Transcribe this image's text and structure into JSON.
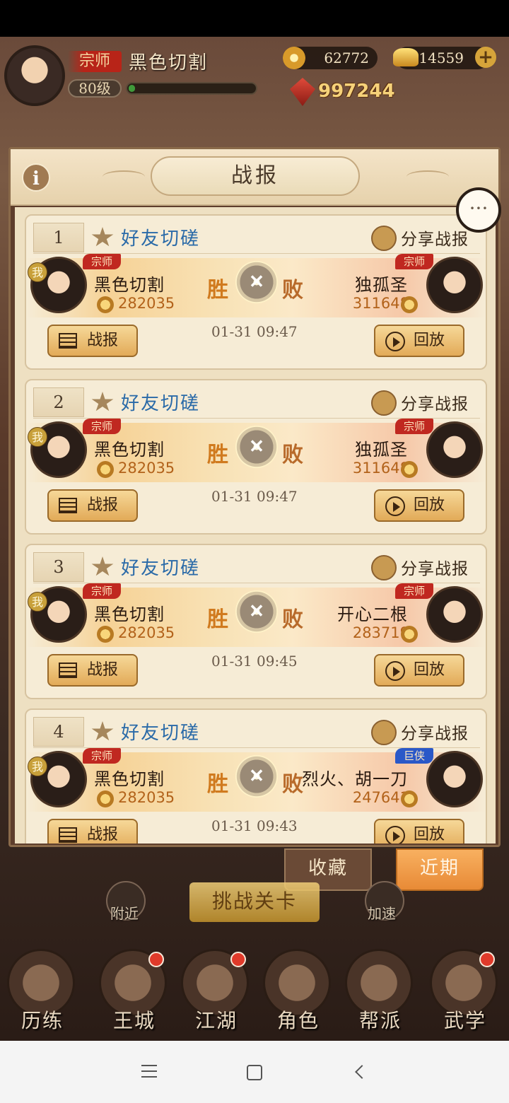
{
  "hud": {
    "rank": "宗师",
    "player_name": "黑色切割",
    "level": "80级",
    "exp_fraction": 0.05,
    "copper": "62772",
    "gold": "14559",
    "power": "997244"
  },
  "dialog": {
    "title": "战报",
    "info_icon": "i",
    "chat_icon": "···"
  },
  "cards": [
    {
      "index": "1",
      "type": "好友切磋",
      "share": "分享战报",
      "me_badge": "我",
      "left": {
        "title": "宗师",
        "name": "黑色切割",
        "power": "282035"
      },
      "right": {
        "title": "宗师",
        "name": "独孤圣",
        "power": "311648",
        "title_color": "red"
      },
      "win": "胜",
      "lose": "败",
      "time": "01-31 09:47",
      "report_btn": "战报",
      "replay_btn": "回放"
    },
    {
      "index": "2",
      "type": "好友切磋",
      "share": "分享战报",
      "me_badge": "我",
      "left": {
        "title": "宗师",
        "name": "黑色切割",
        "power": "282035"
      },
      "right": {
        "title": "宗师",
        "name": "独孤圣",
        "power": "311648",
        "title_color": "red"
      },
      "win": "胜",
      "lose": "败",
      "time": "01-31 09:47",
      "report_btn": "战报",
      "replay_btn": "回放"
    },
    {
      "index": "3",
      "type": "好友切磋",
      "share": "分享战报",
      "me_badge": "我",
      "left": {
        "title": "宗师",
        "name": "黑色切割",
        "power": "282035"
      },
      "right": {
        "title": "宗师",
        "name": "开心二根",
        "power": "283719",
        "title_color": "red"
      },
      "win": "胜",
      "lose": "败",
      "time": "01-31 09:45",
      "report_btn": "战报",
      "replay_btn": "回放"
    },
    {
      "index": "4",
      "type": "好友切磋",
      "share": "分享战报",
      "me_badge": "我",
      "left": {
        "title": "宗师",
        "name": "黑色切割",
        "power": "282035"
      },
      "right": {
        "title": "巨侠",
        "name": "烈火、胡一刀",
        "power": "247641",
        "title_color": "blue"
      },
      "win": "胜",
      "lose": "败",
      "time": "01-31 09:43",
      "report_btn": "战报",
      "replay_btn": "回放"
    }
  ],
  "tabs": {
    "favorites": "收藏",
    "recent": "近期"
  },
  "challenge_button": "挑战关卡",
  "side": {
    "nearby": "附近",
    "speed": "加速"
  },
  "nav": [
    "历练",
    "王城",
    "江湖",
    "角色",
    "帮派",
    "武学"
  ],
  "nav_badges": [
    false,
    true,
    true,
    false,
    false,
    true
  ],
  "colors": {
    "win": "#d07a1e",
    "mode": "#2a6aa8",
    "title_red": "#c02820",
    "title_blue": "#2a58c8",
    "recent_tab": "#e88a36"
  }
}
